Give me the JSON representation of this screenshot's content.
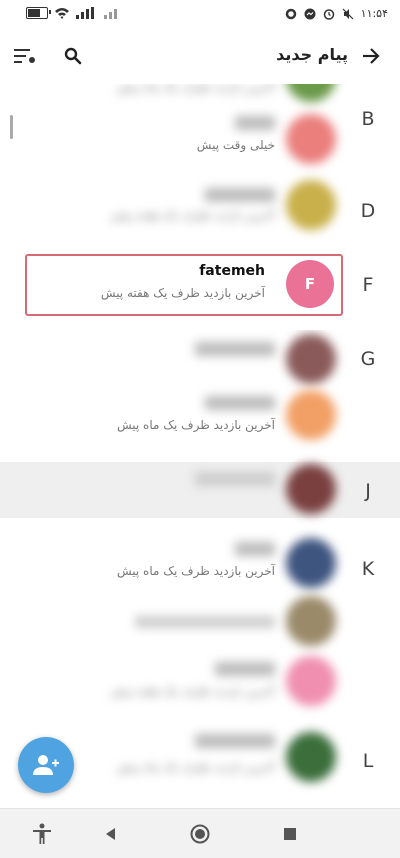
{
  "status_bar": {
    "time": "۱۱:۵۴"
  },
  "header": {
    "title": "پیام جدید"
  },
  "contacts": [
    {
      "letter": "",
      "name": "",
      "status": "آخرین بازدید ظرف یک ماه پیش",
      "color": "#6a9a4a"
    },
    {
      "letter": "B",
      "name": "",
      "status": "خیلی وقت پیش",
      "color": "#ea7f7c"
    },
    {
      "letter": "D",
      "name": "",
      "status": "آخرین بازدید ظرف یک هفته پیش",
      "color": "#c9b04a"
    },
    {
      "letter": "F",
      "name": "fatemeh",
      "status": "آخرین بازدید ظرف یک هفته پیش",
      "avatar_initial": "F",
      "color": "#e97296"
    },
    {
      "letter": "G",
      "name": "",
      "status": "",
      "color": "#8a5a5a"
    },
    {
      "letter": "",
      "name": "",
      "status": "آخرین بازدید ظرف یک ماه پیش",
      "color": "#f2a066"
    },
    {
      "letter": "J",
      "name": "",
      "status": "",
      "color": "#7a4040"
    },
    {
      "letter": "K",
      "name": "",
      "status": "آخرین بازدید ظرف یک ماه پیش",
      "color": "#3e5580"
    },
    {
      "letter": "",
      "name": "",
      "status": "",
      "color": "#9a8a6a"
    },
    {
      "letter": "",
      "name": "",
      "status": "آخرین بازدید ظرف یک هفته پیش",
      "color": "#f08fb0"
    },
    {
      "letter": "L",
      "name": "",
      "status": "آخرین بازدید ظرف یک ماه پیش",
      "color": "#3b6e3b"
    }
  ],
  "icons": {
    "back": "arrow-right-icon",
    "search": "search-icon",
    "sort": "sort-filter-icon",
    "fab": "add-contact-icon",
    "accessibility": "accessibility-icon",
    "nav_back": "nav-back-icon",
    "nav_home": "nav-home-icon",
    "nav_recent": "nav-recent-icon"
  }
}
